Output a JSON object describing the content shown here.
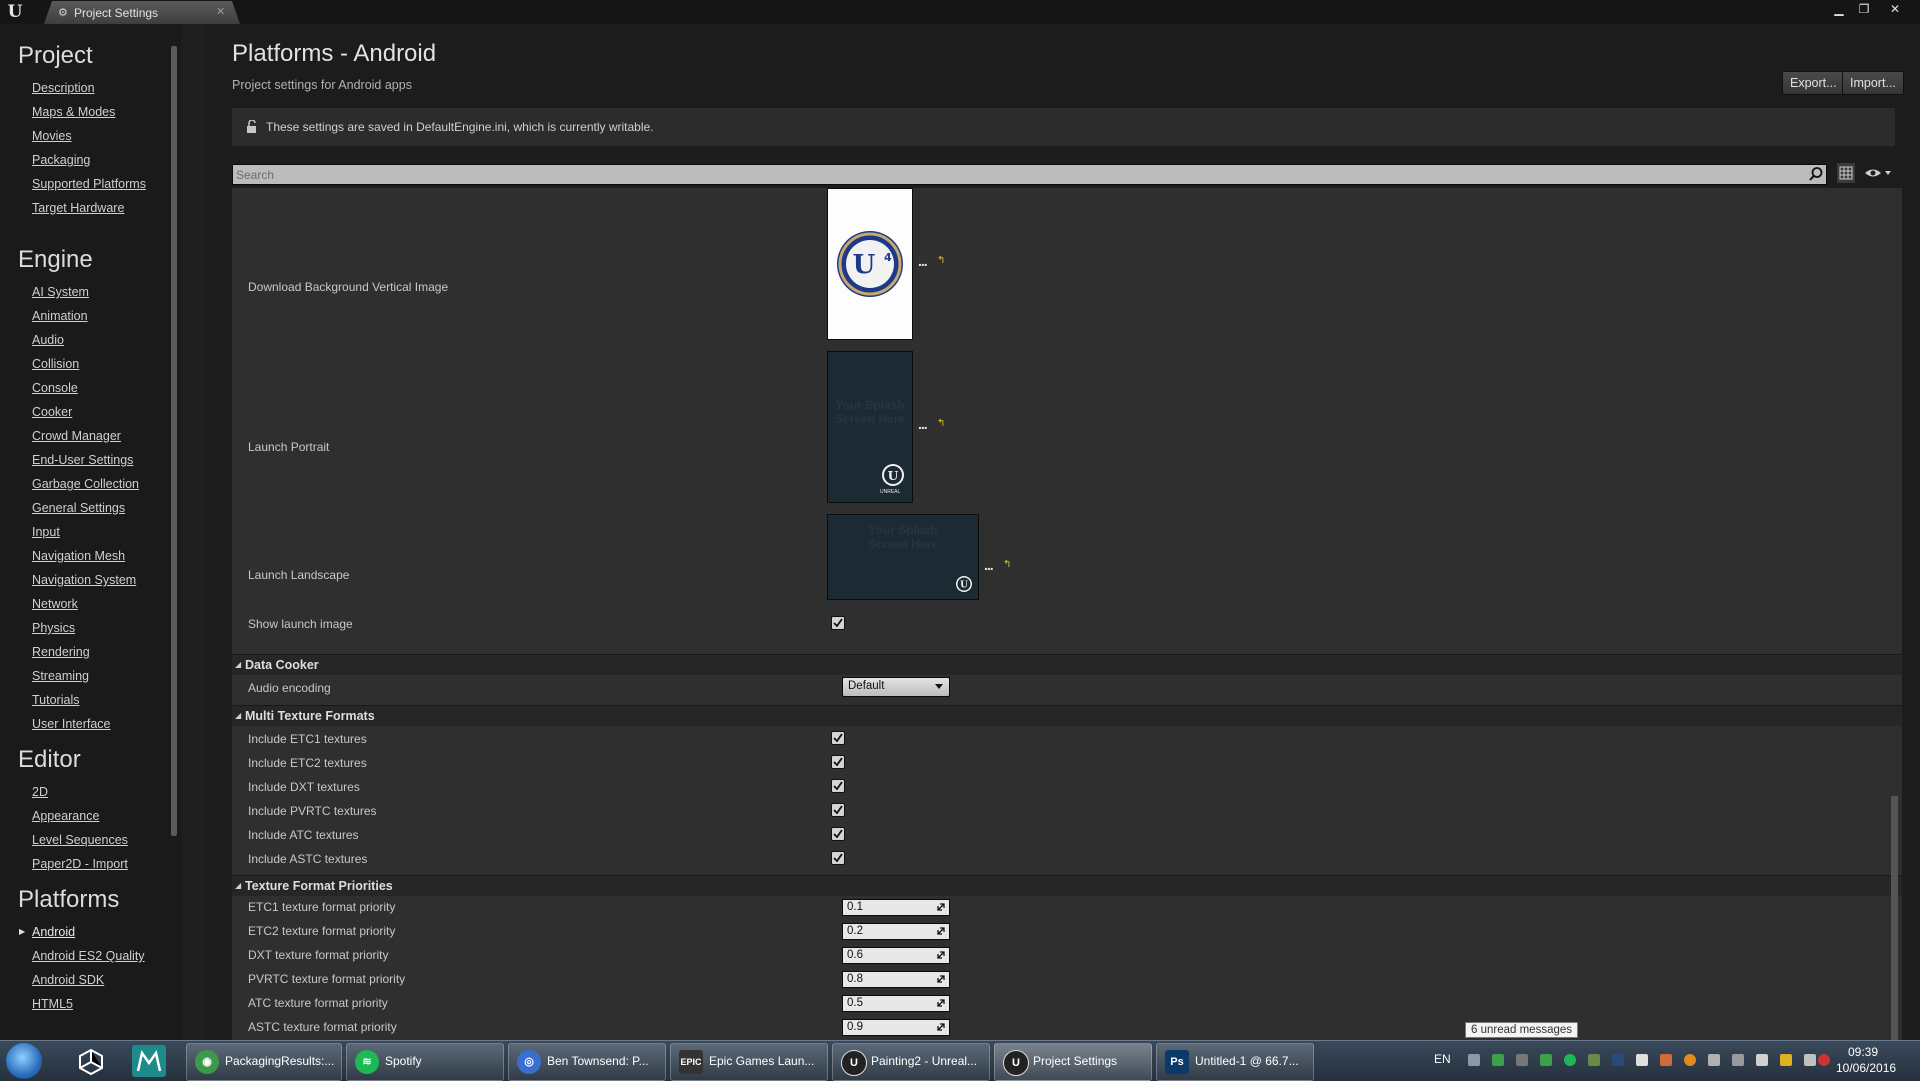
{
  "window": {
    "tab_title": "Project Settings",
    "minimize": "▁",
    "maximize": "❐",
    "close": "✕"
  },
  "sidebar": {
    "sections": [
      {
        "title": "Project",
        "items": [
          "Description",
          "Maps & Modes",
          "Movies",
          "Packaging",
          "Supported Platforms",
          "Target Hardware"
        ]
      },
      {
        "title": "Engine",
        "items": [
          "AI System",
          "Animation",
          "Audio",
          "Collision",
          "Console",
          "Cooker",
          "Crowd Manager",
          "End-User Settings",
          "Garbage Collection",
          "General Settings",
          "Input",
          "Navigation Mesh",
          "Navigation System",
          "Network",
          "Physics",
          "Rendering",
          "Streaming",
          "Tutorials",
          "User Interface"
        ]
      },
      {
        "title": "Editor",
        "items": [
          "2D",
          "Appearance",
          "Level Sequences",
          "Paper2D - Import"
        ]
      },
      {
        "title": "Platforms",
        "items": [
          "Android",
          "Android ES2 Quality",
          "Android SDK",
          "HTML5"
        ],
        "active": "Android"
      }
    ]
  },
  "header": {
    "title": "Platforms - Android",
    "subtitle": "Project settings for Android apps",
    "export_label": "Export...",
    "import_label": "Import..."
  },
  "notice": {
    "text": "These settings are saved in DefaultEngine.ini, which is currently writable."
  },
  "search": {
    "placeholder": "Search"
  },
  "images": {
    "download_bg": "Download Background Vertical Image",
    "launch_portrait": "Launch Portrait",
    "launch_landscape": "Launch Landscape",
    "splash_text": "Your Splash Screen Here",
    "ue_badge": "4",
    "unreal_text": "UNREAL"
  },
  "show_launch_image": {
    "label": "Show launch image",
    "checked": true
  },
  "data_cooker": {
    "title": "Data Cooker",
    "audio_label": "Audio encoding",
    "audio_value": "Default"
  },
  "multi_texture": {
    "title": "Multi Texture Formats",
    "items": [
      {
        "label": "Include ETC1 textures",
        "checked": true
      },
      {
        "label": "Include ETC2 textures",
        "checked": true
      },
      {
        "label": "Include DXT textures",
        "checked": true
      },
      {
        "label": "Include PVRTC textures",
        "checked": true
      },
      {
        "label": "Include ATC textures",
        "checked": true
      },
      {
        "label": "Include ASTC textures",
        "checked": true
      }
    ]
  },
  "priorities": {
    "title": "Texture Format Priorities",
    "items": [
      {
        "label": "ETC1 texture format priority",
        "value": "0.1"
      },
      {
        "label": "ETC2 texture format priority",
        "value": "0.2"
      },
      {
        "label": "DXT texture format priority",
        "value": "0.6"
      },
      {
        "label": "PVRTC texture format priority",
        "value": "0.8"
      },
      {
        "label": "ATC texture format priority",
        "value": "0.5"
      },
      {
        "label": "ASTC texture format priority",
        "value": "0.9"
      }
    ]
  },
  "taskbar": {
    "apps": [
      {
        "label": "PackagingResults:...",
        "icon": "chrome-icon",
        "color": "#3c9a4a"
      },
      {
        "label": "Spotify",
        "icon": "spotify-icon",
        "color": "#1db954"
      },
      {
        "label": "Ben Townsend: P...",
        "icon": "browser-icon",
        "color": "#3a6fd0"
      },
      {
        "label": "Epic Games Laun...",
        "icon": "epic-icon",
        "color": "#333333"
      },
      {
        "label": "Painting2 - Unreal...",
        "icon": "unreal-icon",
        "color": "#222222"
      },
      {
        "label": "Project Settings",
        "icon": "unreal-icon",
        "color": "#222222"
      },
      {
        "label": "Untitled-1 @ 66.7...",
        "icon": "photoshop-icon",
        "color": "#0b3a6a"
      }
    ],
    "tray_lang": "EN",
    "time": "09:39",
    "date": "10/06/2016",
    "tooltip": "6 unread messages"
  },
  "colors": {
    "accent_yellow": "#d8c020",
    "panel_bg": "#2f2f2f",
    "category_bg": "#262626"
  }
}
